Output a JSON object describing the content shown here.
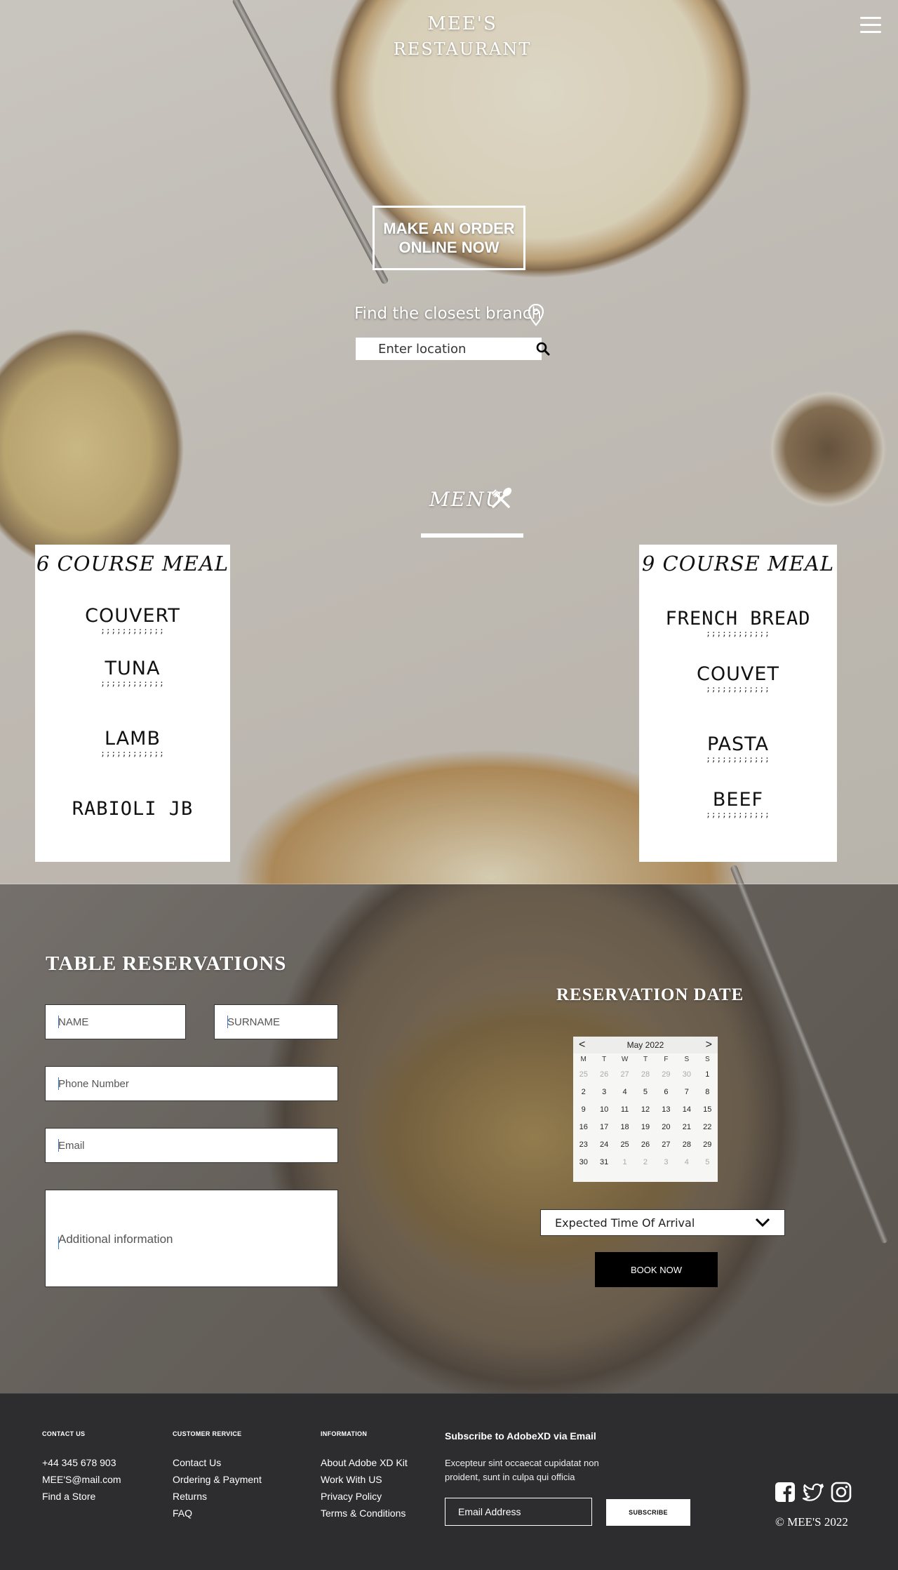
{
  "header": {
    "brand_line1": "MEE'S",
    "brand_line2": "RESTAURANT"
  },
  "hero": {
    "order_button_line1": "MAKE AN ORDER",
    "order_button_line2": "ONLINE NOW",
    "branch_label": "Find the closest branch",
    "location_placeholder": "Enter location"
  },
  "menu": {
    "title": "MENU",
    "six_course": {
      "title": "6 COURSE MEAL",
      "items": [
        "COUVERT",
        "TUNA",
        "LAMB",
        "RABIOLI JB"
      ],
      "dots": ";;;;;;;;;;;;"
    },
    "nine_course": {
      "title": "9 COURSE MEAL",
      "items": [
        "FRENCH BREAD",
        "COUVET",
        "PASTA",
        "BEEF"
      ],
      "dots": ";;;;;;;;;;;;"
    }
  },
  "reservation": {
    "title": "TABLE RESERVATIONS",
    "name_placeholder": "NAME",
    "surname_placeholder": "SURNAME",
    "phone_placeholder": "Phone Number",
    "email_placeholder": "Email",
    "info_placeholder": "Additional information",
    "date_title": "RESERVATION DATE",
    "calendar": {
      "month": "May 2022",
      "prev": "<",
      "next": ">",
      "weekdays": [
        "M",
        "T",
        "W",
        "T",
        "F",
        "S",
        "S"
      ],
      "weeks": [
        [
          "25",
          "26",
          "27",
          "28",
          "29",
          "30",
          "1"
        ],
        [
          "2",
          "3",
          "4",
          "5",
          "6",
          "7",
          "8"
        ],
        [
          "9",
          "10",
          "11",
          "12",
          "13",
          "14",
          "15"
        ],
        [
          "16",
          "17",
          "18",
          "19",
          "20",
          "21",
          "22"
        ],
        [
          "23",
          "24",
          "25",
          "26",
          "27",
          "28",
          "29"
        ],
        [
          "30",
          "31",
          "1",
          "2",
          "3",
          "4",
          "5"
        ]
      ]
    },
    "eta_label": "Expected Time Of Arrival",
    "book_label": "BOOK NOW"
  },
  "footer": {
    "contact": {
      "heading": "CONTACT US",
      "items": [
        "+44 345 678 903",
        "MEE'S@mail.com",
        "Find a Store"
      ]
    },
    "customer": {
      "heading": "CUSTOMER RERVICE",
      "items": [
        "Contact Us",
        "Ordering & Payment",
        "Returns",
        "FAQ"
      ]
    },
    "information": {
      "heading": "INFORMATION",
      "items": [
        "About Adobe XD Kit",
        "Work With US",
        "Privacy Policy",
        "Terms & Conditions"
      ]
    },
    "subscribe_title": "Subscribe to AdobeXD via Email",
    "subscribe_text": "Excepteur sint occaecat cupidatat non proident, sunt in culpa qui officia",
    "email_placeholder": "Email Address",
    "subscribe_button": "SUBSCRIBE",
    "copyright": "© MEE'S 2022",
    "social_icons": [
      "facebook-icon",
      "twitter-icon",
      "instagram-icon"
    ]
  }
}
